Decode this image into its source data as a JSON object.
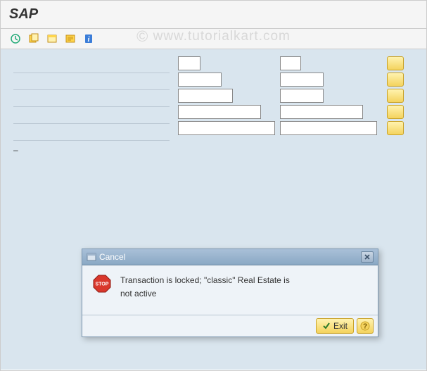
{
  "app": {
    "title": "SAP"
  },
  "watermark": {
    "symbol": "©",
    "text": "www.tutorialkart.com"
  },
  "toolbar": {
    "items": [
      {
        "name": "execute-icon"
      },
      {
        "name": "get-variant-icon"
      },
      {
        "name": "new-window-icon"
      },
      {
        "name": "spool-icon"
      },
      {
        "name": "info-icon"
      }
    ]
  },
  "form": {
    "rows": [
      {
        "w1": 32,
        "w2": 30
      },
      {
        "w1": 62,
        "w2": 62
      },
      {
        "w1": 78,
        "w2": 62
      },
      {
        "w1": 118,
        "w2": 118
      },
      {
        "w1": 138,
        "w2": 138
      }
    ]
  },
  "dialog": {
    "title": "Cancel",
    "message_line1": "Transaction is locked; \"classic\" Real Estate is",
    "message_line2": "not active",
    "exit_label": "Exit"
  }
}
